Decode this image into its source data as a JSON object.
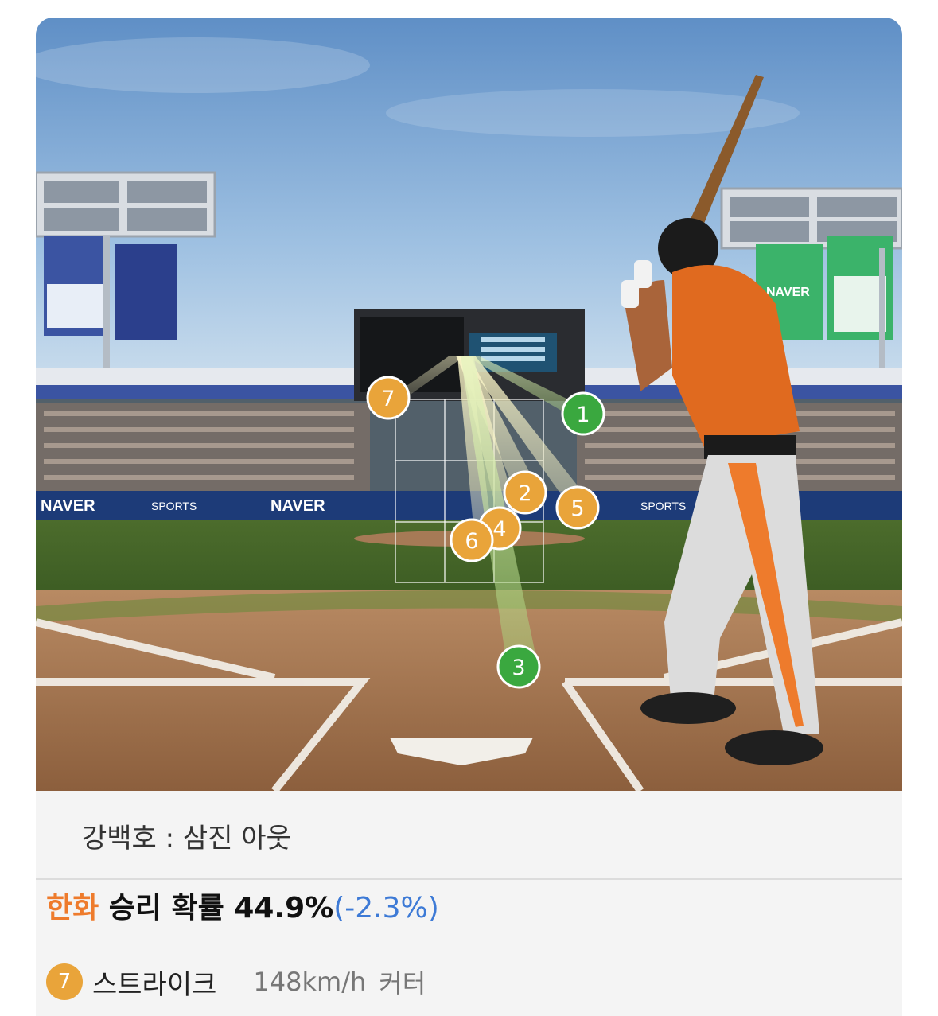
{
  "scene": {
    "banner_brand": "NAVER",
    "banner_sports": "SPORTS",
    "pitches": [
      {
        "number": "1",
        "color": "#3aa83f"
      },
      {
        "number": "2",
        "color": "#e9a43a"
      },
      {
        "number": "3",
        "color": "#3aa83f"
      },
      {
        "number": "4",
        "color": "#e9a43a"
      },
      {
        "number": "5",
        "color": "#e9a43a"
      },
      {
        "number": "6",
        "color": "#e9a43a"
      },
      {
        "number": "7",
        "color": "#e9a43a"
      }
    ]
  },
  "result": {
    "text": "강백호 : 삼진 아웃"
  },
  "win_probability": {
    "team": "한화",
    "label": " 승리 확률 44.9%",
    "delta": "(-2.3%)"
  },
  "last_pitch": {
    "number": "7",
    "type": "스트라이크",
    "speed": "148km/h",
    "kind": "커터"
  },
  "colors": {
    "accent_orange": "#ee7b2c",
    "delta_blue": "#3d7ad6",
    "ball_yellow": "#e9a43a",
    "strike_green": "#3aa83f"
  }
}
